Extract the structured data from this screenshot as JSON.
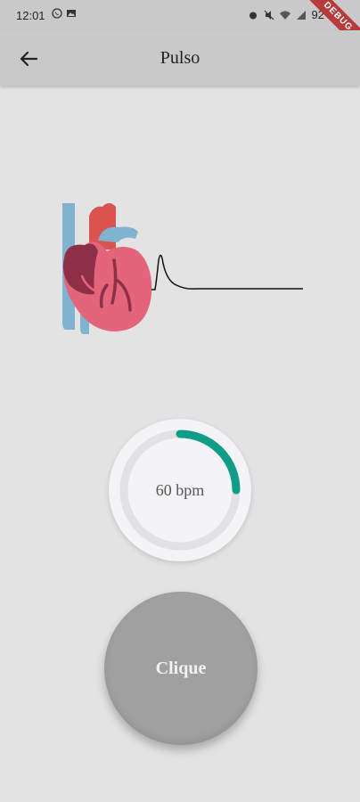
{
  "status_bar": {
    "time": "12:01",
    "battery": "92"
  },
  "debug_banner": "DEBUG",
  "app_bar": {
    "title": "Pulso"
  },
  "meter": {
    "bpm_text": "60 bpm",
    "progress": 0.25,
    "track_color": "#e2e2e6",
    "progress_color": "#0f9d87"
  },
  "button": {
    "label": "Clique"
  },
  "colors": {
    "background": "#e3e3e3",
    "app_bar": "#c9c9c9",
    "button": "#a0a0a0"
  }
}
